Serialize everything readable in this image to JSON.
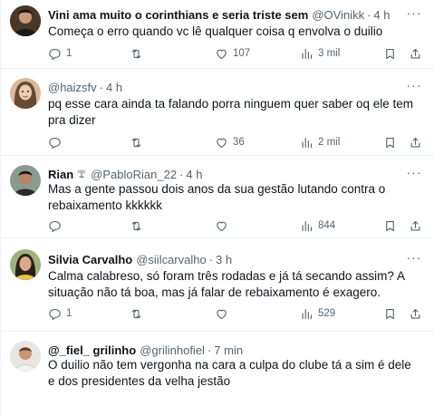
{
  "tweets": [
    {
      "name": "Vini ama muito o corinthians e seria triste sem",
      "handle": "@OVinikk",
      "separator": "·",
      "time": "4 h",
      "text": "Começa o erro quando vc lê qualquer coisa q envolva o duilio",
      "replies": "1",
      "retweets": "",
      "likes": "107",
      "views": "3 mil"
    },
    {
      "name": "",
      "handle": "@haizsfv",
      "separator": "·",
      "time": "4 h",
      "text": "pq esse cara ainda ta falando porra ninguem quer saber oq ele tem pra dizer",
      "replies": "",
      "retweets": "",
      "likes": "36",
      "views": "2 mil"
    },
    {
      "name": "Rian",
      "handle": "@PabloRian_22",
      "separator": "·",
      "time": "4 h",
      "text": "Mas a gente passou dois anos da sua gestão lutando contra o rebaixamento kkkkkk",
      "replies": "",
      "retweets": "",
      "likes": "",
      "views": "844"
    },
    {
      "name": "Silvia Carvalho",
      "handle": "@siilcarvalho",
      "separator": "·",
      "time": "3 h",
      "text": "Calma calabreso, só foram três rodadas e já tá secando assim? A situação não tá boa, mas já falar de rebaixamento é exagero.",
      "replies": "1",
      "retweets": "",
      "likes": "",
      "views": "529"
    },
    {
      "name": "@_fiel_ grilinho",
      "handle": "@grilinhofiel",
      "separator": "·",
      "time": "7 min",
      "text": "O duilio não  tem vergonha na cara a culpa do clube tá a sim é dele e dos presidentes da velha  jestão",
      "replies": "",
      "retweets": "",
      "likes": "",
      "views": ""
    }
  ],
  "icons": {
    "reply": "reply-icon",
    "retweet": "retweet-icon",
    "like": "heart-icon",
    "views": "views-icon",
    "bookmark": "bookmark-icon",
    "share": "share-icon",
    "more": "more-icon"
  },
  "colors": {
    "text": "#0f1419",
    "muted": "#536471",
    "divider": "#eff3f4"
  }
}
